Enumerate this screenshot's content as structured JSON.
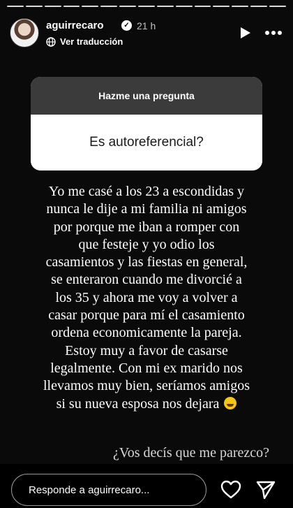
{
  "header": {
    "username": "aguirrecaro",
    "time": "21 h",
    "translate_label": "Ver traducción"
  },
  "progress": {
    "segments": 15,
    "current_segment": 15
  },
  "question_box": {
    "title": "Hazme una pregunta",
    "question": "Es autoreferencial?"
  },
  "answer": {
    "lines": [
      "Yo me casé a los 23 a escondidas y",
      "nunca le dije a mi familia ni amigos",
      "por porque me iban a romper con",
      "que festeje y yo odio los",
      "casamientos y las fiestas en general,",
      "se enteraron cuando me divorcié a",
      "los 35 y ahora me voy a volver a",
      "casar porque para mí el casamiento",
      "ordena economicamente la pareja.",
      "Estoy muy a favor de casarse",
      "legalmente. Con mi ex marido nos",
      "llevamos muy bien, seríamos amigos",
      "si su nueva esposa nos dejara"
    ],
    "closing": "¿Vos decís que me parezco?"
  },
  "reply_bar": {
    "placeholder": "Responde a aguirrecaro..."
  },
  "colors": {
    "background": "#000000",
    "question_header": "#3b3b3b",
    "question_body": "#ffffff",
    "text": "#ffffff"
  },
  "icons": [
    "verified-badge-icon",
    "globe-icon",
    "play-icon",
    "more-icon",
    "laughing-emoji-icon",
    "heart-icon",
    "send-icon"
  ]
}
